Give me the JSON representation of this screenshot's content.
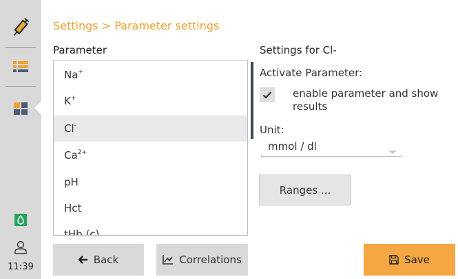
{
  "sidebar": {
    "items": [
      {
        "icon": "syringe-icon"
      },
      {
        "icon": "list-icon",
        "color": "#f0a035"
      },
      {
        "icon": "grid-icon",
        "color": "#f0a035"
      }
    ],
    "status": {
      "icon": "drop-icon",
      "color": "#24a35a"
    },
    "user_icon": "user-icon",
    "time": "11:39"
  },
  "breadcrumb": "Settings > Parameter settings",
  "parameter_panel": {
    "title": "Parameter",
    "items": [
      {
        "base": "Na",
        "sup": "+"
      },
      {
        "base": "K",
        "sup": "+"
      },
      {
        "base": "Cl",
        "sup": "-"
      },
      {
        "base": "Ca",
        "sup": "2+"
      },
      {
        "base": "pH",
        "sup": ""
      },
      {
        "base": "Hct",
        "sup": ""
      },
      {
        "base": "tHb (c)",
        "sup": ""
      }
    ],
    "selected": "Cl"
  },
  "settings_panel": {
    "title": "Settings for Cl-",
    "activate_label": "Activate Parameter:",
    "checkbox_checked": true,
    "checkbox_text": "enable parameter and show results",
    "unit_label": "Unit:",
    "unit_value": "mmol / dl",
    "ranges_button": "Ranges ..."
  },
  "footer": {
    "back_label": "Back",
    "correlations_label": "Correlations",
    "save_label": "Save"
  },
  "colors": {
    "accent": "#f0a035",
    "primary_button": "#f5a744",
    "status_green": "#24a35a",
    "scroll_indicator": "#3d4556"
  }
}
